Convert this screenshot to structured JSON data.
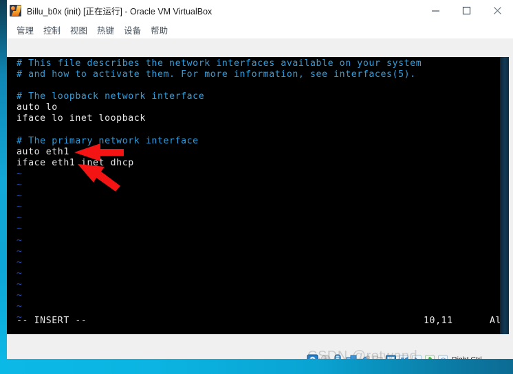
{
  "window": {
    "title": "Billu_b0x (init) [正在运行] - Oracle VM VirtualBox",
    "icon": "virtualbox-icon",
    "buttons": {
      "minimize": "minimize-icon",
      "maximize": "maximize-icon",
      "close": "close-icon"
    }
  },
  "menubar": {
    "items": [
      {
        "label": "管理"
      },
      {
        "label": "控制"
      },
      {
        "label": "视图"
      },
      {
        "label": "热键"
      },
      {
        "label": "设备"
      },
      {
        "label": "帮助"
      }
    ]
  },
  "terminal": {
    "lines": [
      {
        "text": "# This file describes the network interfaces available on your system",
        "style": "comment"
      },
      {
        "text": "# and how to activate them. For more information, see interfaces(5).",
        "style": "comment"
      },
      {
        "text": "",
        "style": "blank"
      },
      {
        "text": "# The loopback network interface",
        "style": "comment"
      },
      {
        "text": "auto lo",
        "style": "text"
      },
      {
        "text": "iface lo inet loopback",
        "style": "text"
      },
      {
        "text": "",
        "style": "blank"
      },
      {
        "text": "# The primary network interface",
        "style": "comment"
      },
      {
        "text": "auto eth1",
        "style": "text"
      },
      {
        "text": "iface eth1 inet dhcp",
        "style": "text"
      },
      {
        "text": "~",
        "style": "tilde"
      },
      {
        "text": "~",
        "style": "tilde"
      },
      {
        "text": "~",
        "style": "tilde"
      },
      {
        "text": "~",
        "style": "tilde"
      },
      {
        "text": "~",
        "style": "tilde"
      },
      {
        "text": "~",
        "style": "tilde"
      },
      {
        "text": "~",
        "style": "tilde"
      },
      {
        "text": "~",
        "style": "tilde"
      },
      {
        "text": "~",
        "style": "tilde"
      },
      {
        "text": "~",
        "style": "tilde"
      },
      {
        "text": "~",
        "style": "tilde"
      },
      {
        "text": "~",
        "style": "tilde"
      },
      {
        "text": "~",
        "style": "tilde"
      },
      {
        "text": "~",
        "style": "tilde"
      }
    ],
    "statusline": {
      "mode": "-- INSERT --",
      "position": "10,11",
      "scroll": "All"
    },
    "colors": {
      "background": "#000000",
      "comment": "#2e9fe0",
      "text": "#e9e9e9",
      "tilde": "#2451c7"
    }
  },
  "annotations": {
    "arrow_color": "#f41414",
    "arrows": [
      {
        "name": "arrow-auto-eth1",
        "target": "auto eth1"
      },
      {
        "name": "arrow-iface-eth1",
        "target": "iface eth1 inet dhcp"
      }
    ]
  },
  "statusbar": {
    "icons": [
      {
        "name": "hard-disk-icon"
      },
      {
        "name": "optical-disc-icon"
      },
      {
        "name": "audio-icon"
      },
      {
        "name": "network-icon"
      },
      {
        "name": "usb-icon"
      },
      {
        "name": "shared-folder-icon"
      },
      {
        "name": "display-icon"
      },
      {
        "name": "recording-icon"
      },
      {
        "name": "mouse-integration-icon"
      },
      {
        "name": "keyboard-icon"
      },
      {
        "name": "host-key-icon"
      }
    ],
    "host_key": "Right Ctrl"
  },
  "watermark": {
    "text": "CSDN @rotwand"
  }
}
